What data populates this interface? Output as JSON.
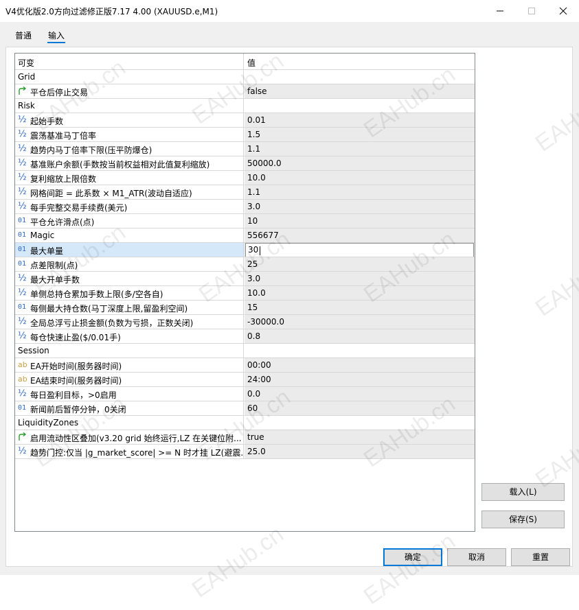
{
  "window": {
    "title": "V4优化版2.0方向过滤修正版7.17 4.00 (XAUUSD.e,M1)"
  },
  "tabs": [
    {
      "label": "普通"
    },
    {
      "label": "输入"
    }
  ],
  "grid": {
    "header": {
      "name": "可变",
      "value": "值"
    },
    "rows": [
      {
        "kind": "group",
        "name": "Grid"
      },
      {
        "kind": "param",
        "icon": "bool",
        "name": "平仓后停止交易",
        "value": "false"
      },
      {
        "kind": "group",
        "name": "Risk"
      },
      {
        "kind": "param",
        "icon": "double",
        "name": "起始手数",
        "value": "0.01"
      },
      {
        "kind": "param",
        "icon": "double",
        "name": "震荡基准马丁倍率",
        "value": "1.5"
      },
      {
        "kind": "param",
        "icon": "double",
        "name": "趋势内马丁倍率下限(压平防爆仓)",
        "value": "1.1"
      },
      {
        "kind": "param",
        "icon": "double",
        "name": "基准账户余额(手数按当前权益相对此值复利缩放)",
        "value": "50000.0"
      },
      {
        "kind": "param",
        "icon": "double",
        "name": "复利缩放上限倍数",
        "value": "10.0"
      },
      {
        "kind": "param",
        "icon": "double",
        "name": "网格间距 = 此系数 × M1_ATR(波动自适应)",
        "value": "1.1"
      },
      {
        "kind": "param",
        "icon": "double",
        "name": "每手完整交易手续费(美元)",
        "value": "3.0"
      },
      {
        "kind": "param",
        "icon": "int",
        "name": "平仓允许滑点(点)",
        "value": "10"
      },
      {
        "kind": "param",
        "icon": "int",
        "name": "Magic",
        "value": "556677"
      },
      {
        "kind": "param",
        "icon": "int",
        "name": "最大单量",
        "value": "30",
        "selected": true
      },
      {
        "kind": "param",
        "icon": "int",
        "name": "点差限制(点)",
        "value": "25"
      },
      {
        "kind": "param",
        "icon": "double",
        "name": "最大开单手数",
        "value": "3.0"
      },
      {
        "kind": "param",
        "icon": "double",
        "name": "单侧总持仓累加手数上限(多/空各自)",
        "value": "10.0"
      },
      {
        "kind": "param",
        "icon": "int",
        "name": "每侧最大持仓数(马丁深度上限,留盈利空间)",
        "value": "15"
      },
      {
        "kind": "param",
        "icon": "double",
        "name": "全局总浮亏止损金额(负数为亏损，正数关闭)",
        "value": "-30000.0"
      },
      {
        "kind": "param",
        "icon": "double",
        "name": "每仓快速止盈($/0.01手)",
        "value": "0.8"
      },
      {
        "kind": "group",
        "name": "Session"
      },
      {
        "kind": "param",
        "icon": "string",
        "name": "EA开始时间(服务器时间)",
        "value": "00:00"
      },
      {
        "kind": "param",
        "icon": "string",
        "name": "EA结束时间(服务器时间)",
        "value": "24:00"
      },
      {
        "kind": "param",
        "icon": "double",
        "name": "每日盈利目标，>0启用",
        "value": "0.0"
      },
      {
        "kind": "param",
        "icon": "int",
        "name": "新闻前后暂停分钟，0关闭",
        "value": "60"
      },
      {
        "kind": "group",
        "name": "LiquidityZones"
      },
      {
        "kind": "param",
        "icon": "bool",
        "name": "启用流动性区叠加(v3.20 grid 始终运行,LZ 在关键位附...",
        "value": "true"
      },
      {
        "kind": "param",
        "icon": "double",
        "name": "趋势门控:仅当 |g_market_score| >= N 时才挂 LZ(避震...",
        "value": "25.0"
      }
    ]
  },
  "icons": {
    "double": "½",
    "int": "01",
    "string": "ab",
    "bool": "bool-arrow-icon"
  },
  "buttons": {
    "load": "载入(L)",
    "save": "保存(S)",
    "ok": "确定",
    "cancel": "取消",
    "reset": "重置"
  },
  "watermark": "EAHub.cn",
  "colors": {
    "accent": "#0078d7",
    "selection": "#d5e8fa",
    "value_bg": "#ebebeb",
    "bool_icon": "#2aa02a"
  }
}
